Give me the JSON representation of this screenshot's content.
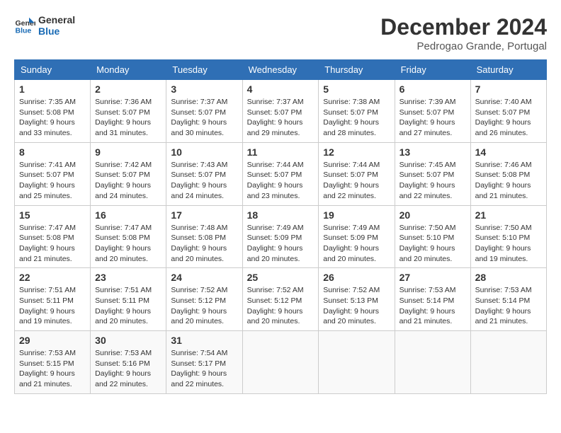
{
  "logo": {
    "line1": "General",
    "line2": "Blue"
  },
  "title": "December 2024",
  "location": "Pedrogao Grande, Portugal",
  "days_header": [
    "Sunday",
    "Monday",
    "Tuesday",
    "Wednesday",
    "Thursday",
    "Friday",
    "Saturday"
  ],
  "weeks": [
    [
      {
        "day": 1,
        "sunrise": "7:35 AM",
        "sunset": "5:08 PM",
        "daylight": "9 hours and 33 minutes."
      },
      {
        "day": 2,
        "sunrise": "7:36 AM",
        "sunset": "5:07 PM",
        "daylight": "9 hours and 31 minutes."
      },
      {
        "day": 3,
        "sunrise": "7:37 AM",
        "sunset": "5:07 PM",
        "daylight": "9 hours and 30 minutes."
      },
      {
        "day": 4,
        "sunrise": "7:37 AM",
        "sunset": "5:07 PM",
        "daylight": "9 hours and 29 minutes."
      },
      {
        "day": 5,
        "sunrise": "7:38 AM",
        "sunset": "5:07 PM",
        "daylight": "9 hours and 28 minutes."
      },
      {
        "day": 6,
        "sunrise": "7:39 AM",
        "sunset": "5:07 PM",
        "daylight": "9 hours and 27 minutes."
      },
      {
        "day": 7,
        "sunrise": "7:40 AM",
        "sunset": "5:07 PM",
        "daylight": "9 hours and 26 minutes."
      }
    ],
    [
      {
        "day": 8,
        "sunrise": "7:41 AM",
        "sunset": "5:07 PM",
        "daylight": "9 hours and 25 minutes."
      },
      {
        "day": 9,
        "sunrise": "7:42 AM",
        "sunset": "5:07 PM",
        "daylight": "9 hours and 24 minutes."
      },
      {
        "day": 10,
        "sunrise": "7:43 AM",
        "sunset": "5:07 PM",
        "daylight": "9 hours and 24 minutes."
      },
      {
        "day": 11,
        "sunrise": "7:44 AM",
        "sunset": "5:07 PM",
        "daylight": "9 hours and 23 minutes."
      },
      {
        "day": 12,
        "sunrise": "7:44 AM",
        "sunset": "5:07 PM",
        "daylight": "9 hours and 22 minutes."
      },
      {
        "day": 13,
        "sunrise": "7:45 AM",
        "sunset": "5:07 PM",
        "daylight": "9 hours and 22 minutes."
      },
      {
        "day": 14,
        "sunrise": "7:46 AM",
        "sunset": "5:08 PM",
        "daylight": "9 hours and 21 minutes."
      }
    ],
    [
      {
        "day": 15,
        "sunrise": "7:47 AM",
        "sunset": "5:08 PM",
        "daylight": "9 hours and 21 minutes."
      },
      {
        "day": 16,
        "sunrise": "7:47 AM",
        "sunset": "5:08 PM",
        "daylight": "9 hours and 20 minutes."
      },
      {
        "day": 17,
        "sunrise": "7:48 AM",
        "sunset": "5:08 PM",
        "daylight": "9 hours and 20 minutes."
      },
      {
        "day": 18,
        "sunrise": "7:49 AM",
        "sunset": "5:09 PM",
        "daylight": "9 hours and 20 minutes."
      },
      {
        "day": 19,
        "sunrise": "7:49 AM",
        "sunset": "5:09 PM",
        "daylight": "9 hours and 20 minutes."
      },
      {
        "day": 20,
        "sunrise": "7:50 AM",
        "sunset": "5:10 PM",
        "daylight": "9 hours and 20 minutes."
      },
      {
        "day": 21,
        "sunrise": "7:50 AM",
        "sunset": "5:10 PM",
        "daylight": "9 hours and 19 minutes."
      }
    ],
    [
      {
        "day": 22,
        "sunrise": "7:51 AM",
        "sunset": "5:11 PM",
        "daylight": "9 hours and 19 minutes."
      },
      {
        "day": 23,
        "sunrise": "7:51 AM",
        "sunset": "5:11 PM",
        "daylight": "9 hours and 20 minutes."
      },
      {
        "day": 24,
        "sunrise": "7:52 AM",
        "sunset": "5:12 PM",
        "daylight": "9 hours and 20 minutes."
      },
      {
        "day": 25,
        "sunrise": "7:52 AM",
        "sunset": "5:12 PM",
        "daylight": "9 hours and 20 minutes."
      },
      {
        "day": 26,
        "sunrise": "7:52 AM",
        "sunset": "5:13 PM",
        "daylight": "9 hours and 20 minutes."
      },
      {
        "day": 27,
        "sunrise": "7:53 AM",
        "sunset": "5:14 PM",
        "daylight": "9 hours and 21 minutes."
      },
      {
        "day": 28,
        "sunrise": "7:53 AM",
        "sunset": "5:14 PM",
        "daylight": "9 hours and 21 minutes."
      }
    ],
    [
      {
        "day": 29,
        "sunrise": "7:53 AM",
        "sunset": "5:15 PM",
        "daylight": "9 hours and 21 minutes."
      },
      {
        "day": 30,
        "sunrise": "7:53 AM",
        "sunset": "5:16 PM",
        "daylight": "9 hours and 22 minutes."
      },
      {
        "day": 31,
        "sunrise": "7:54 AM",
        "sunset": "5:17 PM",
        "daylight": "9 hours and 22 minutes."
      },
      null,
      null,
      null,
      null
    ]
  ]
}
